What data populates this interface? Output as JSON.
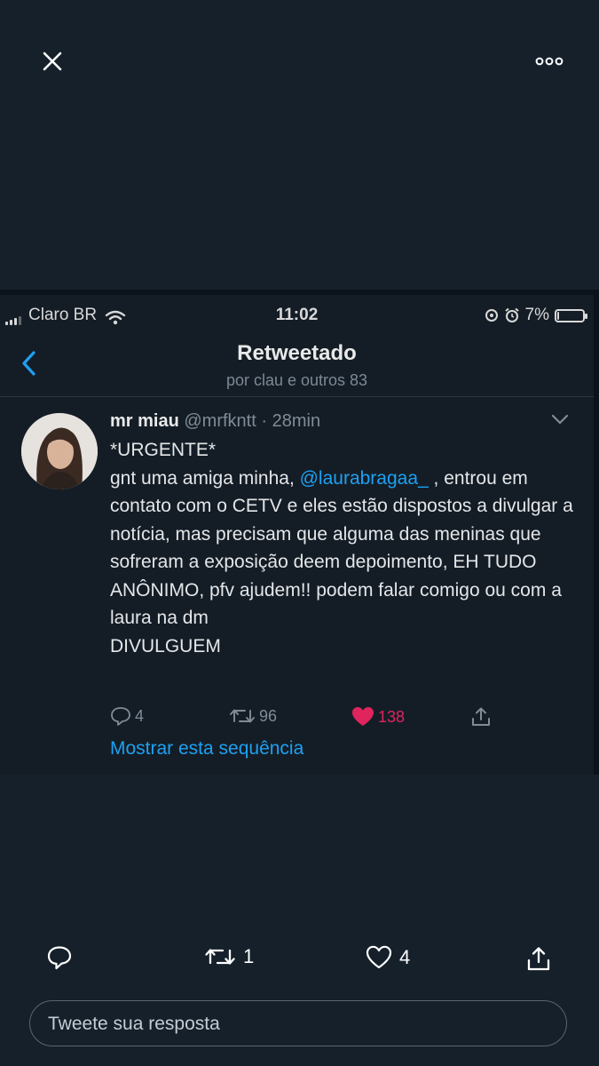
{
  "viewer": {
    "close_icon": "close-icon",
    "more_icon": "more-options-icon"
  },
  "screenshot": {
    "status_bar": {
      "carrier": "Claro BR",
      "time": "11:02",
      "battery": "7%",
      "battery_level": 0.07
    },
    "header": {
      "title": "Retweetado",
      "subtitle": "por clau e outros 83"
    },
    "tweet": {
      "name": "mr miau",
      "handle": "@mrfkntt",
      "separator": "·",
      "time": "28min",
      "line1": "*URGENTE*",
      "text_before_mention": "gnt uma amiga minha, ",
      "mention": "@laurabragaa_",
      "text_after_mention": " , entrou em contato com o CETV e eles estão dispostos a divulgar a notícia, mas precisam que alguma das meninas que sofreram a exposição deem depoimento, EH TUDO ANÔNIMO, pfv ajudem!! podem falar comigo ou com a laura na dm\nDIVULGUEM",
      "replies": "4",
      "retweets": "96",
      "likes": "138",
      "thread_link": "Mostrar esta sequência"
    }
  },
  "actions": {
    "retweets": "1",
    "likes": "4"
  },
  "reply": {
    "placeholder": "Tweete sua resposta"
  },
  "colors": {
    "background": "#15202b",
    "link": "#1da1f2",
    "like": "#e0245e"
  }
}
